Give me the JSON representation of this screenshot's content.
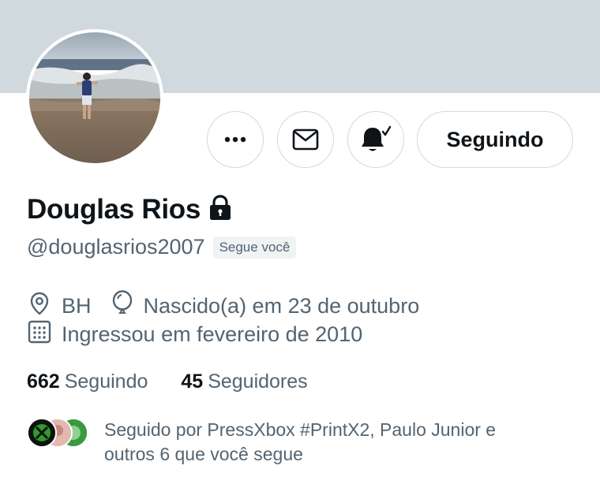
{
  "profile": {
    "name": "Douglas Rios",
    "handle": "@douglasrios2007",
    "follows_you_badge": "Segue você",
    "location": "BH",
    "birthday": "Nascido(a) em 23 de outubro",
    "joined": "Ingressou em fevereiro de 2010"
  },
  "actions": {
    "more_icon": "more-icon",
    "message_icon": "mail-icon",
    "notify_icon": "bell-check-icon",
    "follow_label": "Seguindo"
  },
  "stats": {
    "following_count": "662",
    "following_label": "Seguindo",
    "followers_count": "45",
    "followers_label": "Seguidores"
  },
  "followed_by": {
    "text": "Seguido por PressXbox #PrintX2, Paulo Junior e outros 6 que você segue"
  },
  "colors": {
    "banner": "#cfd9de",
    "text_primary": "#0f1419",
    "text_secondary": "#536471",
    "border": "#cfd9de",
    "badge_bg": "#eff3f4"
  }
}
